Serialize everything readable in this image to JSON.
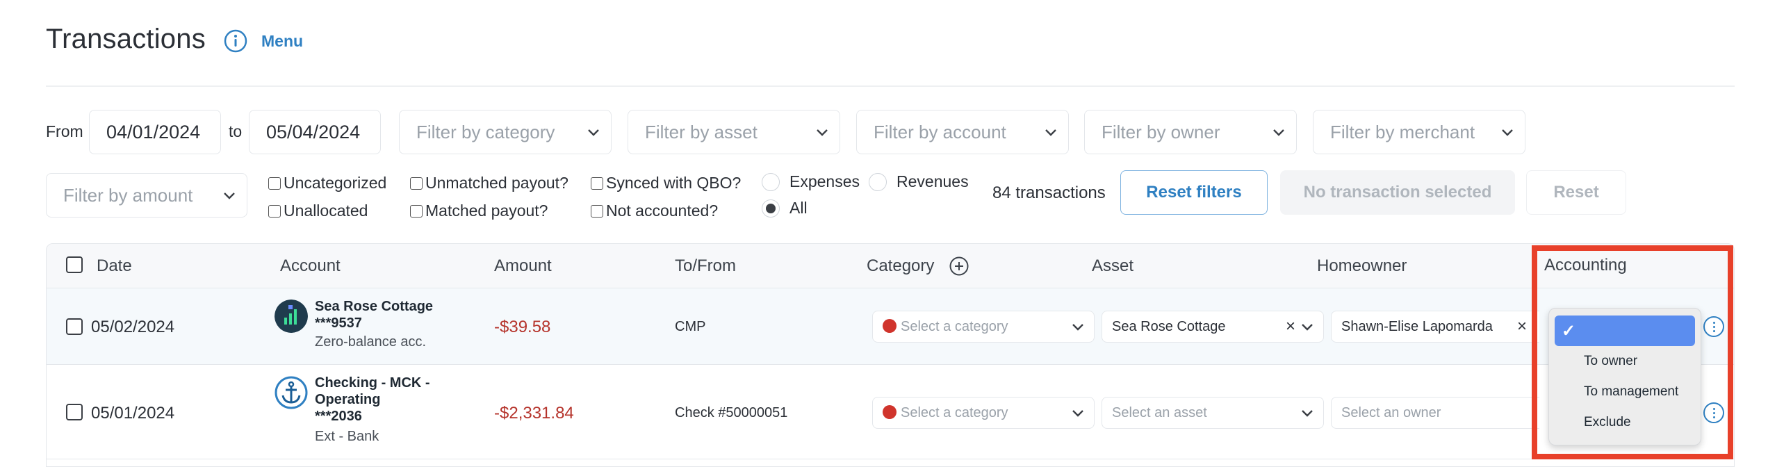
{
  "header": {
    "title": "Transactions",
    "menu_label": "Menu"
  },
  "filters": {
    "from_label": "From",
    "to_label": "to",
    "from_date": "04/01/2024",
    "to_date": "05/04/2024",
    "category_placeholder": "Filter by category",
    "asset_placeholder": "Filter by asset",
    "account_placeholder": "Filter by account",
    "owner_placeholder": "Filter by owner",
    "merchant_placeholder": "Filter by merchant",
    "amount_placeholder": "Filter by amount",
    "checkboxes": {
      "uncategorized": "Uncategorized",
      "unallocated": "Unallocated",
      "unmatched_payout": "Unmatched payout?",
      "matched_payout": "Matched payout?",
      "synced_qbo": "Synced with QBO?",
      "not_accounted": "Not accounted?"
    },
    "radios": {
      "expenses": "Expenses",
      "revenues": "Revenues",
      "all": "All",
      "selected": "All"
    },
    "count_text": "84 transactions",
    "reset_filters": "Reset filters",
    "no_selection": "No transaction selected",
    "reset": "Reset"
  },
  "table": {
    "columns": [
      "Date",
      "Account",
      "Amount",
      "To/From",
      "Category",
      "Asset",
      "Homeowner",
      "Accounting"
    ],
    "rows": [
      {
        "date": "05/02/2024",
        "account_name": "Sea Rose Cottage",
        "account_number": "***9537",
        "account_sub": "Zero-balance acc.",
        "amount": "-$39.58",
        "to_from": "CMP",
        "category": "Select a category",
        "asset": "Sea Rose Cottage",
        "owner": "Shawn-Elise Lapomarda"
      },
      {
        "date": "05/01/2024",
        "account_name_1": "Checking - MCK -",
        "account_name_2": "Operating",
        "account_number": "***2036",
        "account_sub": "Ext - Bank",
        "amount": "-$2,331.84",
        "to_from": "Check #50000051",
        "category": "Select a category",
        "asset": "Select an asset",
        "owner": "Select an owner"
      }
    ]
  },
  "accounting_dropdown": {
    "selected_mark": "✓",
    "options": [
      "To owner",
      "To management",
      "Exclude"
    ]
  },
  "colors": {
    "accent": "#2f80c2",
    "negative": "#b5332b",
    "highlight": "#e8402a",
    "selected_option": "#5b8def"
  }
}
